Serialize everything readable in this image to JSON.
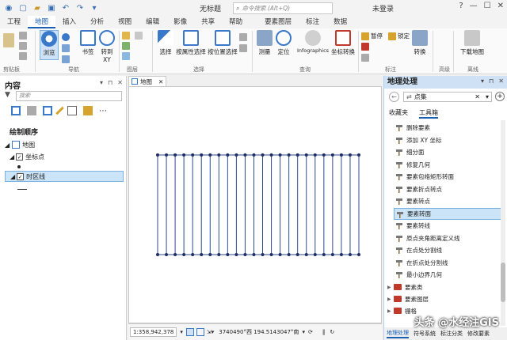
{
  "titlebar": {
    "doc_title": "无标题",
    "search_placeholder": "命令搜索 (Alt+Q)",
    "user": "未登录",
    "window_buttons": [
      "?",
      "—",
      "☐",
      "✕"
    ]
  },
  "tabs": [
    "工程",
    "地图",
    "插入",
    "分析",
    "视图",
    "编辑",
    "影像",
    "共享",
    "帮助",
    "要素图层",
    "标注",
    "数据"
  ],
  "active_tab": "地图",
  "ribbon": {
    "browse": "浏览",
    "bookmarks": "书签",
    "goto_xy_line1": "转到",
    "goto_xy_line2": "XY",
    "nav_group": "导航",
    "clipboard_group": "剪贴板",
    "layer_group": "图层",
    "select": "选择",
    "select_by_attr": "按属性选择",
    "select_by_loc": "按位置选择",
    "selection_group": "选择",
    "measure": "测量",
    "locate": "定位",
    "infographics": "Infographics",
    "coord_convert": "坐标转换",
    "query_group": "查询",
    "pause": "暂停",
    "lock": "锁定",
    "convert": "转换",
    "label_group": "标注",
    "download_map": "下载地图",
    "offline_group": "离线",
    "advanced_group": "高级"
  },
  "left": {
    "title": "内容",
    "search_placeholder": "搜索",
    "draw_order": "绘制顺序",
    "layers": [
      {
        "label": "地图",
        "checked": false
      },
      {
        "label": "坐标点",
        "checked": true
      },
      {
        "label": "时区线",
        "checked": true
      }
    ]
  },
  "map": {
    "tab_label": "地图",
    "scale": "1:358,942,378",
    "coords": "3740490°西 194.5143047°南",
    "line_count": 24,
    "line_color": "#2c4a8c",
    "dot_color": "#1e2d66"
  },
  "geoprocessing": {
    "title": "地理处理",
    "search_value": "点集",
    "tabs": [
      "收藏夹",
      "工具箱"
    ],
    "active_tab": "工具箱",
    "tools": [
      "删除要素",
      "添加 XY 坐标",
      "细分面",
      "修复几何",
      "要素包络矩形转面",
      "要素折点转点",
      "要素转点",
      "要素转面",
      "要素转线",
      "原点夹角距离定义线",
      "在点处分割线",
      "在折点处分割线",
      "最小边界几何"
    ],
    "selected_tool": "要素转面",
    "toolboxes": [
      "要素类",
      "要素图层",
      "栅格"
    ],
    "bottom_tabs": [
      "地理处理",
      "符号系统",
      "标注分类",
      "修改要素"
    ],
    "active_bottom_tab": "地理处理"
  },
  "watermark": "头条 @水经注GIS",
  "colors": {
    "accent": "#1a5fb4",
    "selection": "#cce4f7",
    "ribbon_blue": "#3a78c9"
  }
}
